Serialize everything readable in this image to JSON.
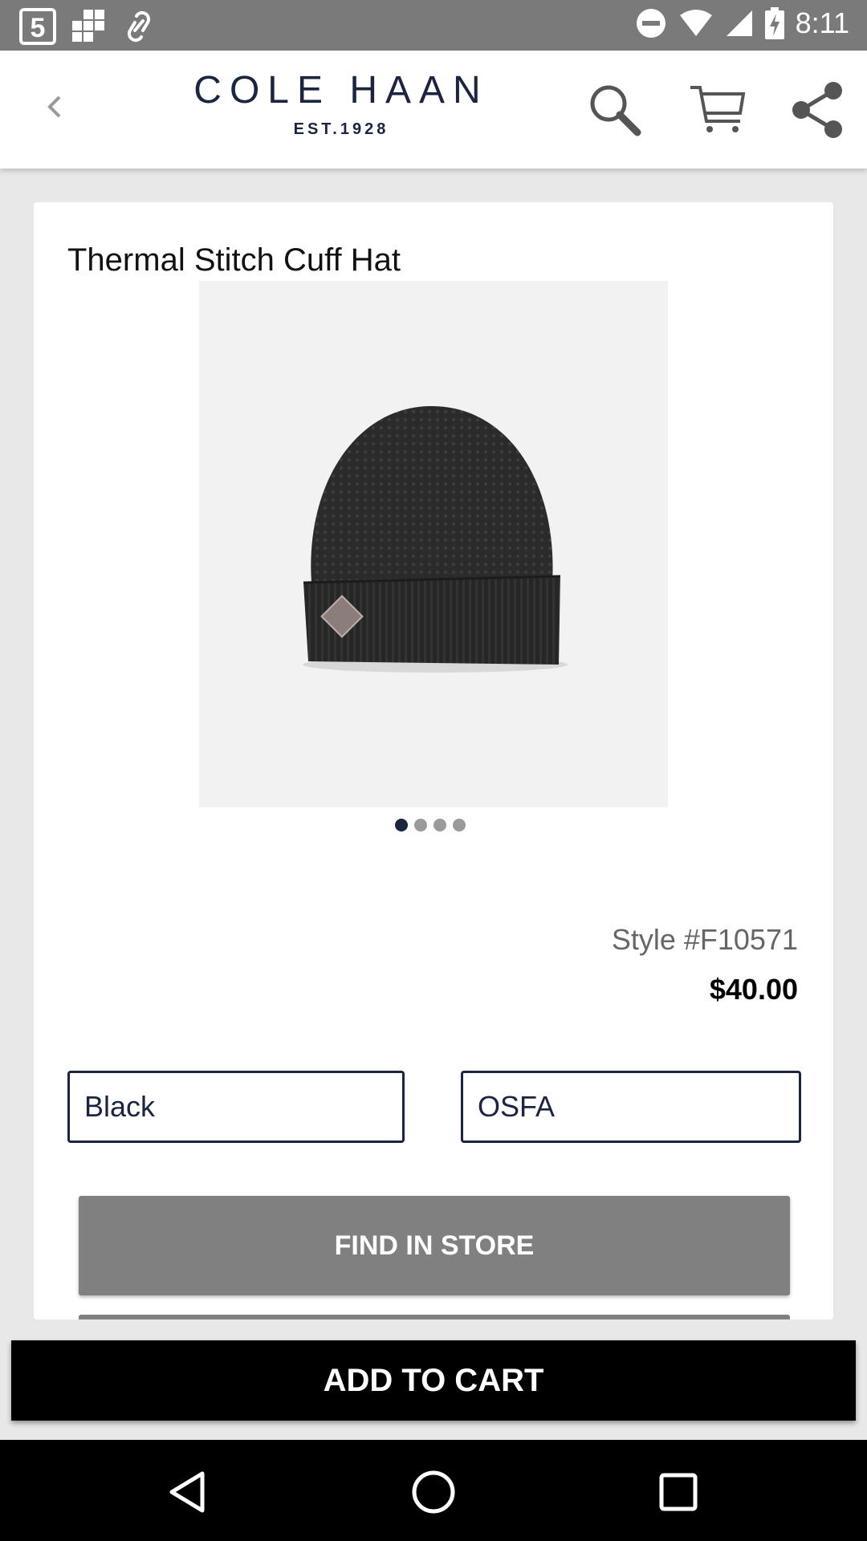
{
  "status_bar": {
    "time": "8:11",
    "left_icons": [
      "five-app-icon",
      "grid-app-icon",
      "link-app-icon"
    ],
    "right_icons": [
      "do-not-disturb-icon",
      "wifi-icon",
      "signal-icon",
      "battery-charging-icon"
    ]
  },
  "app_bar": {
    "back_label": "‹",
    "brand_name": "COLE HAAN",
    "brand_established": "EST.1928",
    "actions": [
      "search-icon",
      "cart-icon",
      "share-icon"
    ]
  },
  "product": {
    "title": "Thermal Stitch Cuff Hat",
    "image_count": 4,
    "active_image_index": 0,
    "style_number": "Style #F10571",
    "price": "$40.00",
    "color_select": "Black",
    "size_select": "OSFA",
    "find_in_store_label": "FIND IN STORE",
    "add_to_cart_label": "ADD TO CART"
  },
  "colors": {
    "brand_navy": "#1b2540",
    "find_button": "#808080",
    "add_to_cart": "#000000",
    "status_bar": "#7a7a7a"
  },
  "nav_bar": [
    "back-triangle-icon",
    "home-circle-icon",
    "recents-square-icon"
  ]
}
